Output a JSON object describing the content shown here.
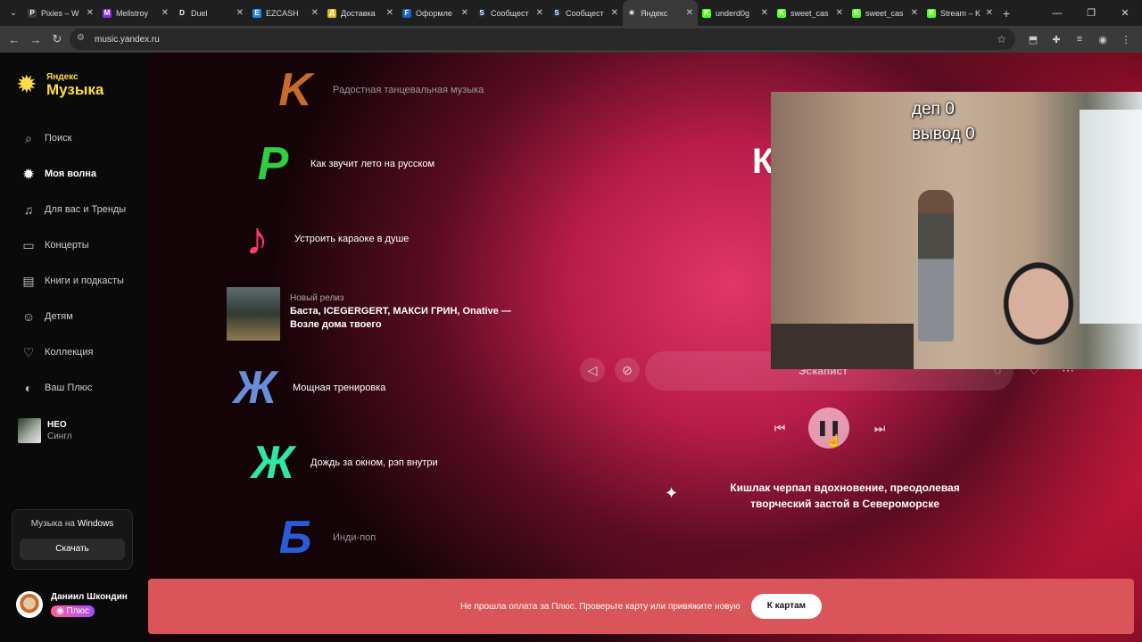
{
  "browser": {
    "tabs": [
      {
        "label": "Pixies – W",
        "fav": "P",
        "color": "#3b3b3b"
      },
      {
        "label": "Mellstroy",
        "fav": "M",
        "color": "#8a2be2"
      },
      {
        "label": "Duel",
        "fav": "D",
        "color": "#222"
      },
      {
        "label": "EZCASH",
        "fav": "E",
        "color": "#1e88e5"
      },
      {
        "label": "Доставка",
        "fav": "Д",
        "color": "#e6b800"
      },
      {
        "label": "Оформле",
        "fav": "F",
        "color": "#1565c0"
      },
      {
        "label": "Сообщест",
        "fav": "S",
        "color": "#1b2838"
      },
      {
        "label": "Сообщест",
        "fav": "S",
        "color": "#1b2838"
      },
      {
        "label": "Яндекс",
        "fav": "☀",
        "color": "#3a3a3a"
      },
      {
        "label": "underd0g",
        "fav": "K",
        "color": "#53fc18"
      },
      {
        "label": "sweet_cas",
        "fav": "K",
        "color": "#53fc18"
      },
      {
        "label": "sweet_cas",
        "fav": "K",
        "color": "#53fc18"
      },
      {
        "label": "Stream – K",
        "fav": "K",
        "color": "#53fc18"
      }
    ],
    "url": "music.yandex.ru"
  },
  "sidebar": {
    "logo_top": "Яндекс",
    "logo_bottom": "Музыка",
    "menu": [
      {
        "label": "Поиск",
        "icon": "search-icon",
        "glyph": "⌕"
      },
      {
        "label": "Моя волна",
        "icon": "wave-icon",
        "glyph": "✹"
      },
      {
        "label": "Для вас и Тренды",
        "icon": "note-icon",
        "glyph": "♫"
      },
      {
        "label": "Концерты",
        "icon": "ticket-icon",
        "glyph": "▭"
      },
      {
        "label": "Книги и подкасты",
        "icon": "book-icon",
        "glyph": "▤"
      },
      {
        "label": "Детям",
        "icon": "kids-icon",
        "glyph": "☺"
      },
      {
        "label": "Коллекция",
        "icon": "heart-icon",
        "glyph": "♡"
      },
      {
        "label": "Ваш Плюс",
        "icon": "plus-icon",
        "glyph": "◐"
      }
    ],
    "now_playing": {
      "title": "НЕО",
      "subtitle": "Сингл"
    },
    "windows_promo": {
      "text_prefix": "Музыка на ",
      "text_bold": "Windows",
      "button": "Скачать"
    },
    "user": {
      "name": "Даниил Шкондин",
      "plus": "Плюс"
    }
  },
  "feed": {
    "items": [
      {
        "label": "Радостная танцевальная музыка",
        "art": "K",
        "color": "#c76a2a",
        "dim": true
      },
      {
        "label": "Как звучит лето на русском",
        "art": "P",
        "color": "#2fcf3f",
        "dim": false
      },
      {
        "label": "Устроить караоке в душе",
        "art": "♪",
        "color": "#ff3b6b",
        "dim": false
      },
      {
        "label": "Мощная тренировка",
        "art": "Ж",
        "color": "#6a8fd9",
        "dim": false
      },
      {
        "label": "Дождь за окном, рэп внутри",
        "art": "Ж",
        "color": "#2ee6a6",
        "dim": false
      },
      {
        "label": "Инди-поп",
        "art": "Б",
        "color": "#2a5bd9",
        "dim": true
      }
    ],
    "release": {
      "tag": "Новый релиз",
      "title": "Баста, ICEGERGERT, МАКСИ ГРИН, Onative — Возле дома твоего"
    }
  },
  "player": {
    "big_letter": "К",
    "track_name": "Эскапист",
    "ai_text": "Кишлак черпал вдохновение, преодолевая творческий застой в Североморске"
  },
  "overlay": {
    "line1": "деп 0",
    "line2": "вывод 0"
  },
  "banner": {
    "text": "Не прошла оплата за Плюс. Проверьте карту или привяжите новую",
    "button": "К картам"
  }
}
